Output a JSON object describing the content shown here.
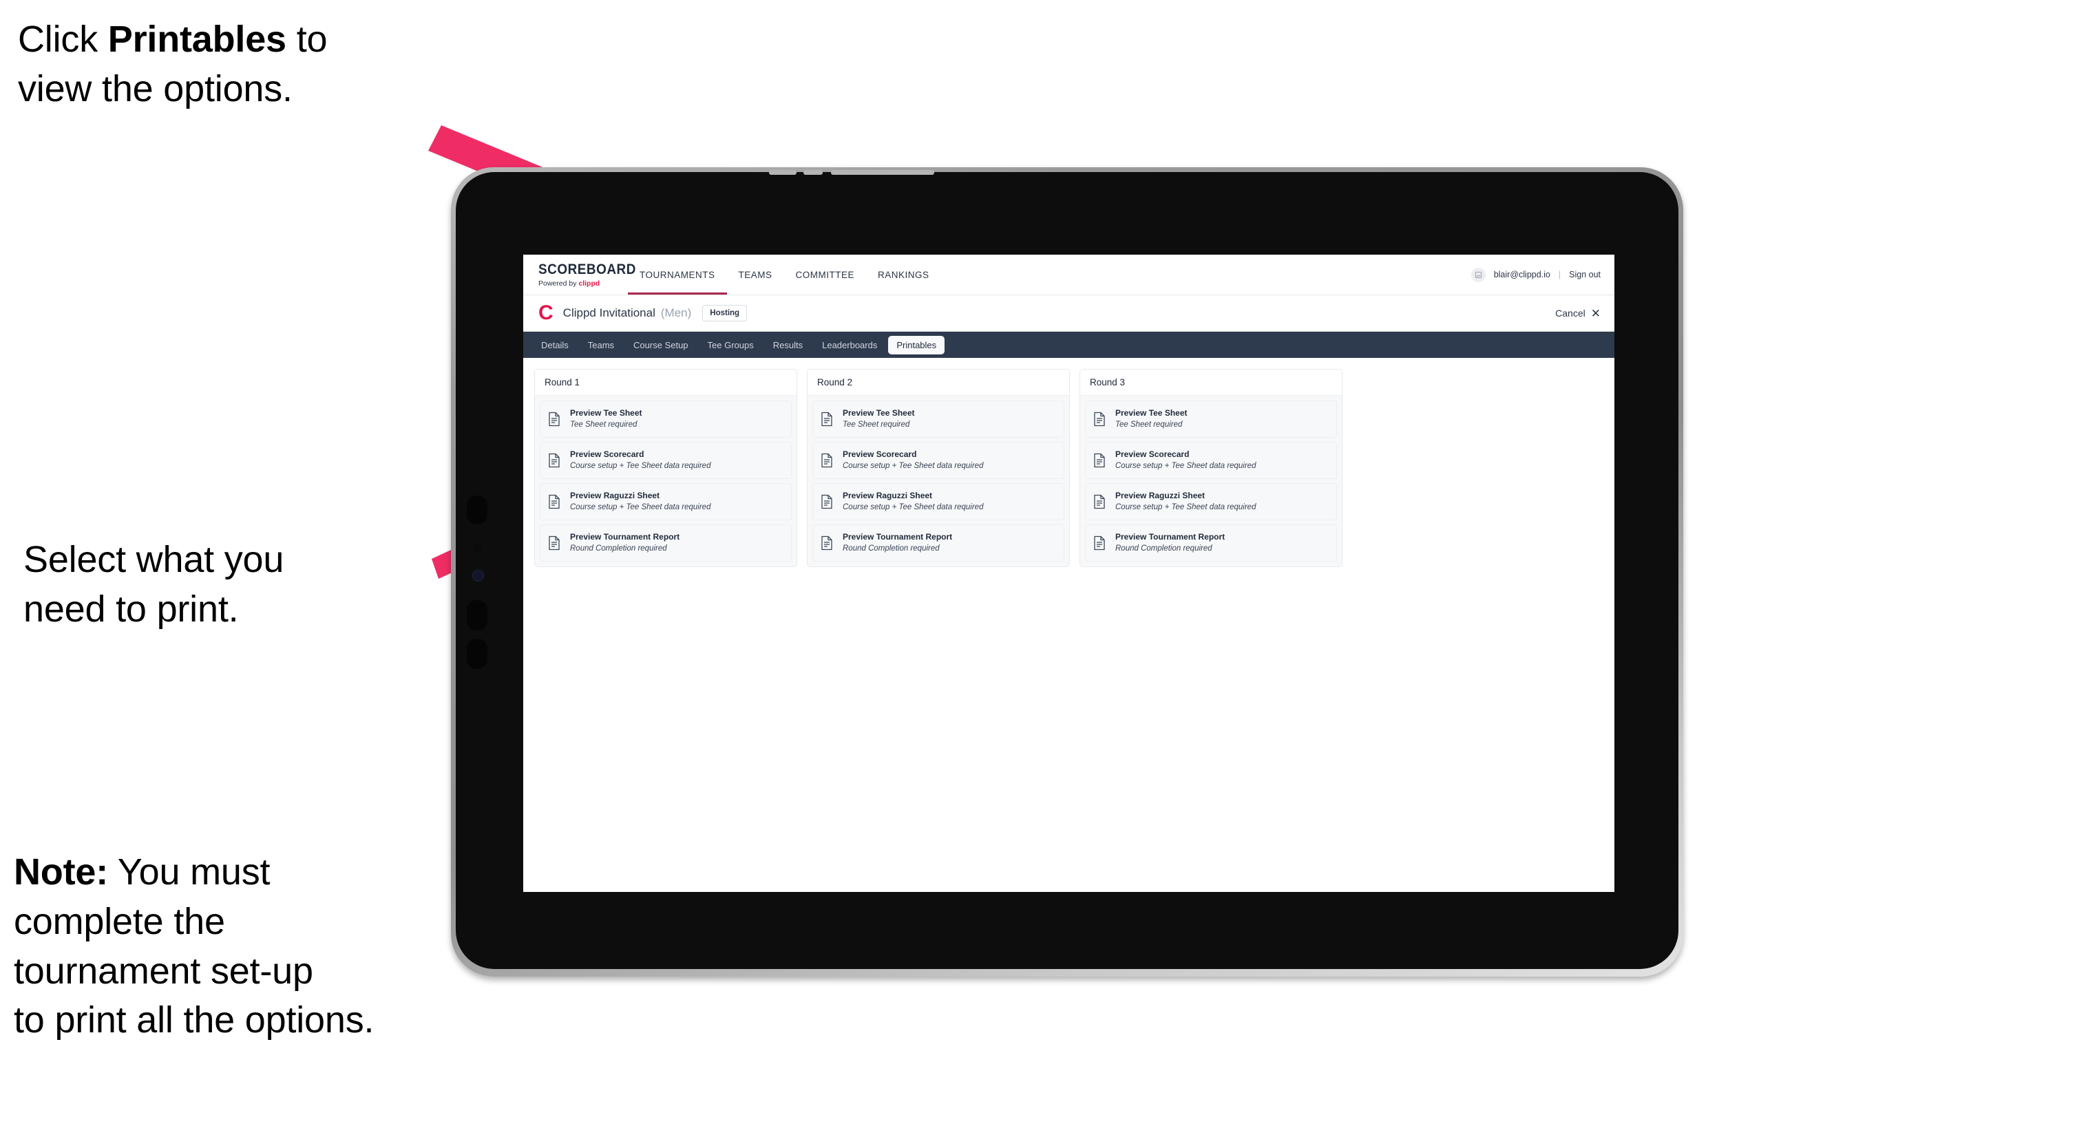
{
  "annotations": {
    "click_printables": {
      "prefix": "Click ",
      "bold": "Printables",
      "suffix": " to\nview the options."
    },
    "select_print": "Select what you\n need to print.",
    "note": {
      "bold": "Note:",
      "rest": " You must\ncomplete the\ntournament set-up\nto print all the options."
    },
    "arrow_color": "#ef2d64"
  },
  "app": {
    "topnav": {
      "brand_title": "SCOREBOARD",
      "brand_sub_prefix": "Powered by ",
      "brand_sub_accent": "clippd",
      "items": [
        {
          "label": "TOURNAMENTS",
          "active": true
        },
        {
          "label": "TEAMS",
          "active": false
        },
        {
          "label": "COMMITTEE",
          "active": false
        },
        {
          "label": "RANKINGS",
          "active": false
        }
      ],
      "avatar_icon": "user-avatar-icon",
      "user_email": "blair@clippd.io",
      "separator": "|",
      "sign_out": "Sign out"
    },
    "subheader": {
      "logo_mark": "C",
      "tournament_name": "Clippd Invitational",
      "gender": "(Men)",
      "hosting_badge": "Hosting",
      "cancel_label": "Cancel",
      "cancel_icon": "✕"
    },
    "tabs": [
      {
        "label": "Details",
        "active": false
      },
      {
        "label": "Teams",
        "active": false
      },
      {
        "label": "Course Setup",
        "active": false
      },
      {
        "label": "Tee Groups",
        "active": false
      },
      {
        "label": "Results",
        "active": false
      },
      {
        "label": "Leaderboards",
        "active": false
      },
      {
        "label": "Printables",
        "active": true
      }
    ],
    "rounds": [
      {
        "header": "Round 1",
        "items": [
          {
            "title": "Preview Tee Sheet",
            "subtitle": "Tee Sheet required"
          },
          {
            "title": "Preview Scorecard",
            "subtitle": "Course setup + Tee Sheet data required"
          },
          {
            "title": "Preview Raguzzi Sheet",
            "subtitle": "Course setup + Tee Sheet data required"
          },
          {
            "title": "Preview Tournament Report",
            "subtitle": "Round Completion required"
          }
        ]
      },
      {
        "header": "Round 2",
        "items": [
          {
            "title": "Preview Tee Sheet",
            "subtitle": "Tee Sheet required"
          },
          {
            "title": "Preview Scorecard",
            "subtitle": "Course setup + Tee Sheet data required"
          },
          {
            "title": "Preview Raguzzi Sheet",
            "subtitle": "Course setup + Tee Sheet data required"
          },
          {
            "title": "Preview Tournament Report",
            "subtitle": "Round Completion required"
          }
        ]
      },
      {
        "header": "Round 3",
        "items": [
          {
            "title": "Preview Tee Sheet",
            "subtitle": "Tee Sheet required"
          },
          {
            "title": "Preview Scorecard",
            "subtitle": "Course setup + Tee Sheet data required"
          },
          {
            "title": "Preview Raguzzi Sheet",
            "subtitle": "Course setup + Tee Sheet data required"
          },
          {
            "title": "Preview Tournament Report",
            "subtitle": "Round Completion required"
          }
        ]
      }
    ],
    "colors": {
      "accent_pink": "#e0174a",
      "tabstrip_dark": "#2e3a4d",
      "active_underline": "#a8274a"
    }
  }
}
